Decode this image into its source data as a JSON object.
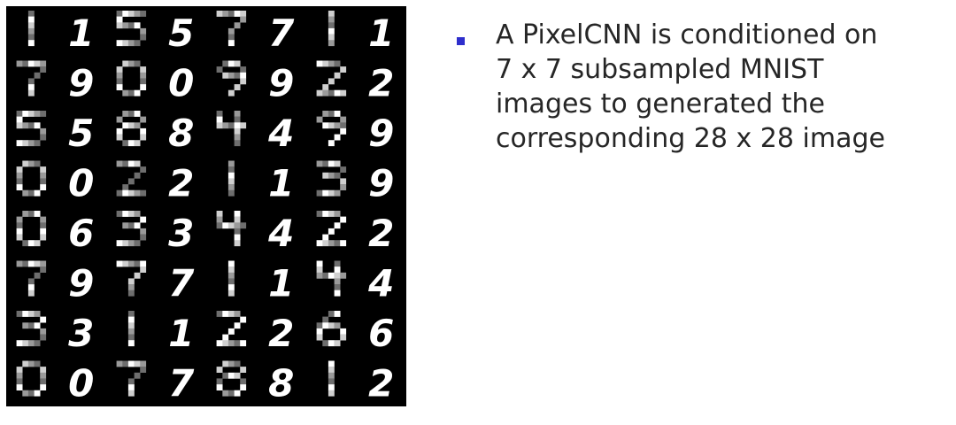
{
  "slide": {
    "bullet": {
      "lines": [
        "A PixelCNN is conditioned on",
        "7 x 7 subsampled MNIST",
        "images to generated the",
        "corresponding 28 x 28 image"
      ]
    },
    "figure": {
      "rows": 8,
      "columns": 8,
      "background_color": "#000000",
      "digit_color": "#ffffff",
      "layout": "alternating columns: blocky 7x7 subsampled input, then smooth 28x28 generated image"
    },
    "colors": {
      "bullet_marker": "#2e2ecc",
      "text": "#262626",
      "background": "#ffffff"
    }
  }
}
